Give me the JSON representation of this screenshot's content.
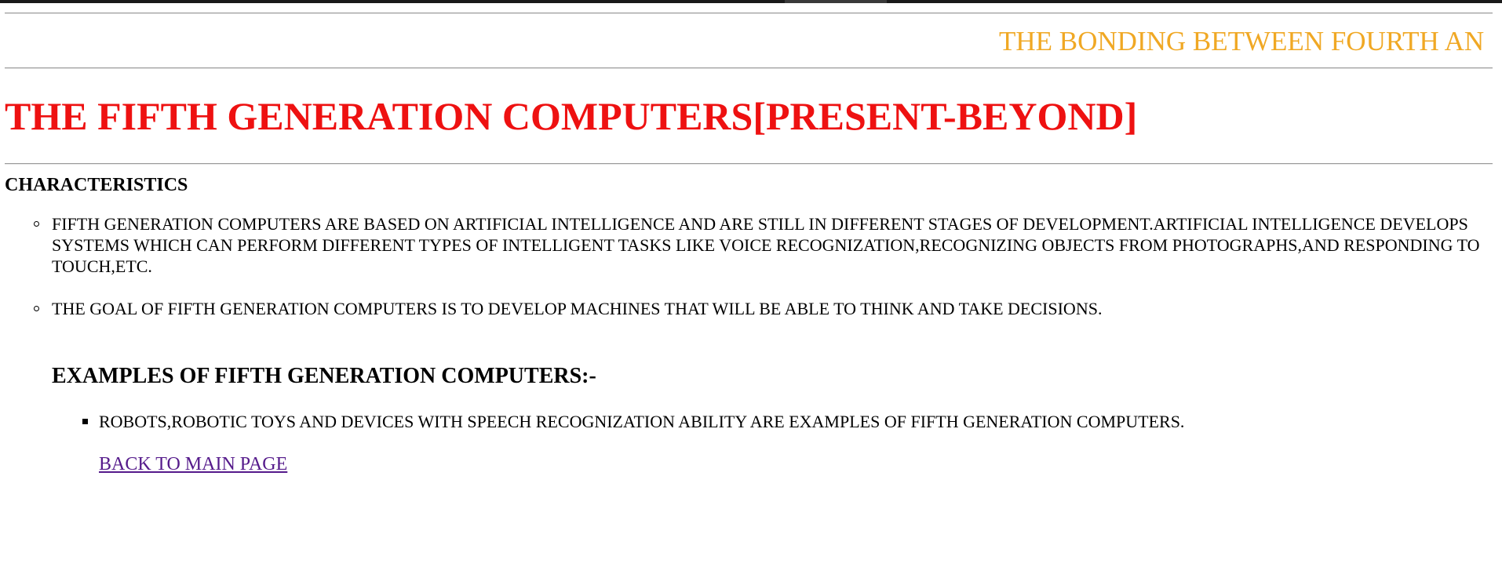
{
  "marquee": {
    "text": "THE BONDING BETWEEN FOURTH AN"
  },
  "page_title": "THE FIFTH GENERATION COMPUTERS[PRESENT-BEYOND]",
  "characteristics": {
    "heading": "CHARACTERISTICS",
    "items": [
      "FIFTH GENERATION COMPUTERS ARE BASED ON ARTIFICIAL INTELLIGENCE AND ARE STILL IN DIFFERENT STAGES OF DEVELOPMENT.ARTIFICIAL INTELLIGENCE DEVELOPS SYSTEMS WHICH CAN PERFORM DIFFERENT TYPES OF INTELLIGENT TASKS LIKE VOICE RECOGNIZATION,RECOGNIZING OBJECTS FROM PHOTOGRAPHS,AND RESPONDING TO TOUCH,ETC.",
      "THE GOAL OF FIFTH GENERATION COMPUTERS IS TO DEVELOP MACHINES THAT WILL BE ABLE TO THINK AND TAKE DECISIONS."
    ]
  },
  "examples": {
    "heading": "EXAMPLES OF FIFTH GENERATION COMPUTERS:-",
    "items": [
      "ROBOTS,ROBOTIC TOYS AND DEVICES WITH SPEECH RECOGNIZATION ABILITY ARE EXAMPLES OF FIFTH GENERATION COMPUTERS."
    ]
  },
  "back_link": "BACK TO MAIN PAGE",
  "colors": {
    "marquee": "#f0a824",
    "title": "#ee1111",
    "visited_link": "#551a8b",
    "text": "#000000"
  }
}
